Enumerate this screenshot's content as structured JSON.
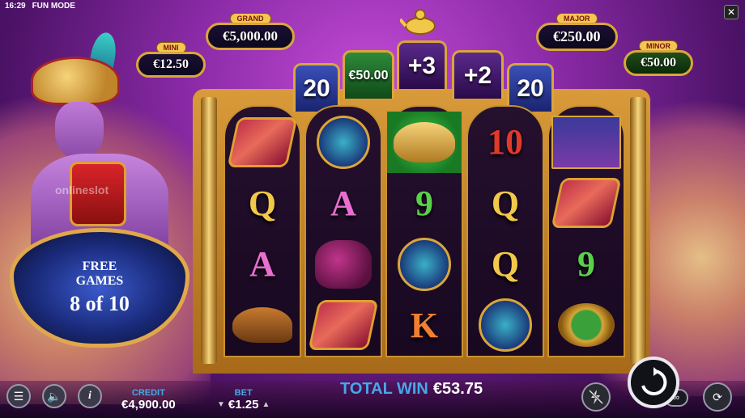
{
  "status_bar": {
    "time": "16:29",
    "mode": "FUN MODE"
  },
  "jackpots": {
    "grand": {
      "label": "GRAND",
      "value": "€5,000.00"
    },
    "mini": {
      "label": "MINI",
      "value": "€12.50"
    },
    "major": {
      "label": "MAJOR",
      "value": "€250.00"
    },
    "minor": {
      "label": "MINOR",
      "value": "€50.00"
    }
  },
  "arch": {
    "segments": [
      "20",
      "€50.00",
      "+3",
      "+2",
      "20"
    ]
  },
  "watermark": "onlineslot",
  "free_games": {
    "title_line1": "FREE",
    "title_line2": "GAMES",
    "count": "8 of 10"
  },
  "reels": [
    [
      "carpet",
      "Q",
      "A",
      "shoe"
    ],
    [
      "swords",
      "A",
      "bag",
      "carpet"
    ],
    [
      "lamp",
      "9",
      "swords",
      "K"
    ],
    [
      "10",
      "Q",
      "Q",
      "swords"
    ],
    [
      "genie",
      "carpet",
      "9",
      "ring"
    ]
  ],
  "bottom": {
    "credit_label": "CREDIT",
    "credit_value": "€4,900.00",
    "bet_label": "BET",
    "bet_value": "€1.25",
    "total_win_label": "TOTAL WIN",
    "total_win_value": "€53.75"
  },
  "icons": {
    "menu": "menu-icon",
    "sound": "speaker-icon",
    "info": "info-icon",
    "turbo": "lightning-off-icon",
    "spin": "spin-icon",
    "autoplay": "autoplay-icon",
    "close": "close-icon"
  }
}
